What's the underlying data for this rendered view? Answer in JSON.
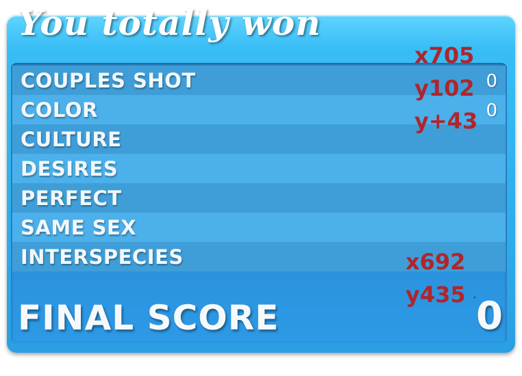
{
  "title": "You totally won",
  "categories": [
    {
      "label": "COUPLES SHOT",
      "score": "0"
    },
    {
      "label": "COLOR",
      "score": "0"
    },
    {
      "label": "CULTURE",
      "score": ""
    },
    {
      "label": "DESIRES",
      "score": ""
    },
    {
      "label": "PERFECT",
      "score": ""
    },
    {
      "label": "SAME SEX",
      "score": ""
    },
    {
      "label": "INTERSPECIES",
      "score": ""
    }
  ],
  "final": {
    "label": "FINAL SCORE",
    "value": "0"
  },
  "annotations": {
    "top_x": "x705",
    "top_y": "y102",
    "top_dy": "y+43",
    "bottom_x": "x692",
    "bottom_y": "y435"
  },
  "colors": {
    "panel": "#38bdf5",
    "row_dark": "#3f9ed8",
    "row_light": "#4cb0ea",
    "annotation_red": "#b0252b"
  }
}
